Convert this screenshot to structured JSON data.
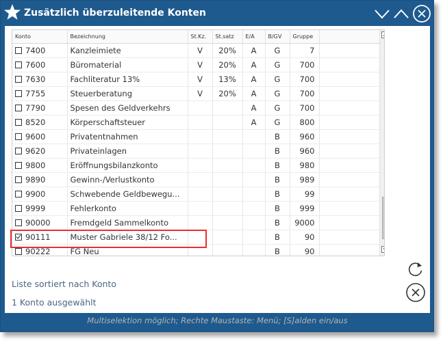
{
  "window": {
    "title": "Zusätzlich überzuleitende Konten",
    "title_icon": "star-icon",
    "buttons": [
      "chevron-down-icon",
      "chevron-up-icon",
      "close-circle-icon"
    ]
  },
  "table": {
    "columns": [
      "Konto",
      "Bezeichnung",
      "St.Kz.",
      "St.satz",
      "E/A",
      "B/GV",
      "Gruppe"
    ],
    "rows": [
      {
        "checked": false,
        "konto": "7400",
        "bezeichnung": "Kanzleimiete",
        "stkz": "V",
        "stsatz": "20%",
        "ea": "A",
        "bgv": "G",
        "gruppe": "7"
      },
      {
        "checked": false,
        "konto": "7600",
        "bezeichnung": "Büromaterial",
        "stkz": "V",
        "stsatz": "20%",
        "ea": "A",
        "bgv": "G",
        "gruppe": "700"
      },
      {
        "checked": false,
        "konto": "7630",
        "bezeichnung": "Fachliteratur 13%",
        "stkz": "V",
        "stsatz": "13%",
        "ea": "A",
        "bgv": "G",
        "gruppe": "700"
      },
      {
        "checked": false,
        "konto": "7755",
        "bezeichnung": "Steuerberatung",
        "stkz": "V",
        "stsatz": "20%",
        "ea": "A",
        "bgv": "G",
        "gruppe": "700"
      },
      {
        "checked": false,
        "konto": "7790",
        "bezeichnung": "Spesen des Geldverkehrs",
        "stkz": "",
        "stsatz": "",
        "ea": "A",
        "bgv": "G",
        "gruppe": "700"
      },
      {
        "checked": false,
        "konto": "8520",
        "bezeichnung": "Körperschaftsteuer",
        "stkz": "",
        "stsatz": "",
        "ea": "A",
        "bgv": "G",
        "gruppe": "800"
      },
      {
        "checked": false,
        "konto": "9600",
        "bezeichnung": "Privatentnahmen",
        "stkz": "",
        "stsatz": "",
        "ea": "",
        "bgv": "B",
        "gruppe": "960"
      },
      {
        "checked": false,
        "konto": "9620",
        "bezeichnung": "Privateinlagen",
        "stkz": "",
        "stsatz": "",
        "ea": "",
        "bgv": "B",
        "gruppe": "960"
      },
      {
        "checked": false,
        "konto": "9800",
        "bezeichnung": "Eröffnungsbilanzkonto",
        "stkz": "",
        "stsatz": "",
        "ea": "",
        "bgv": "B",
        "gruppe": "980"
      },
      {
        "checked": false,
        "konto": "9890",
        "bezeichnung": "Gewinn-/Verlustkonto",
        "stkz": "",
        "stsatz": "",
        "ea": "",
        "bgv": "B",
        "gruppe": "989"
      },
      {
        "checked": false,
        "konto": "9900",
        "bezeichnung": "Schwebende Geldbewegu...",
        "stkz": "",
        "stsatz": "",
        "ea": "",
        "bgv": "B",
        "gruppe": "99"
      },
      {
        "checked": false,
        "konto": "9999",
        "bezeichnung": "Fehlerkonto",
        "stkz": "",
        "stsatz": "",
        "ea": "",
        "bgv": "B",
        "gruppe": "999"
      },
      {
        "checked": false,
        "konto": "90000",
        "bezeichnung": "Fremdgeld Sammelkonto",
        "stkz": "",
        "stsatz": "",
        "ea": "",
        "bgv": "B",
        "gruppe": "9000"
      },
      {
        "checked": true,
        "konto": "90111",
        "bezeichnung": "Muster Gabriele 38/12 Fo...",
        "stkz": "",
        "stsatz": "",
        "ea": "",
        "bgv": "B",
        "gruppe": "90"
      },
      {
        "checked": false,
        "konto": "90222",
        "bezeichnung": "FG Neu",
        "stkz": "",
        "stsatz": "",
        "ea": "",
        "bgv": "B",
        "gruppe": "90"
      }
    ]
  },
  "status": {
    "sort_text": "Liste sortiert nach Konto",
    "selection_text": "1 Konto ausgewählt",
    "hint_text": "Multiselektion möglich; Rechte Maustaste: Menü;    [S]alden ein/aus"
  },
  "colors": {
    "title_bar": "#1e5a8e",
    "highlight_box": "#e53030",
    "status_text": "#4a6582"
  }
}
